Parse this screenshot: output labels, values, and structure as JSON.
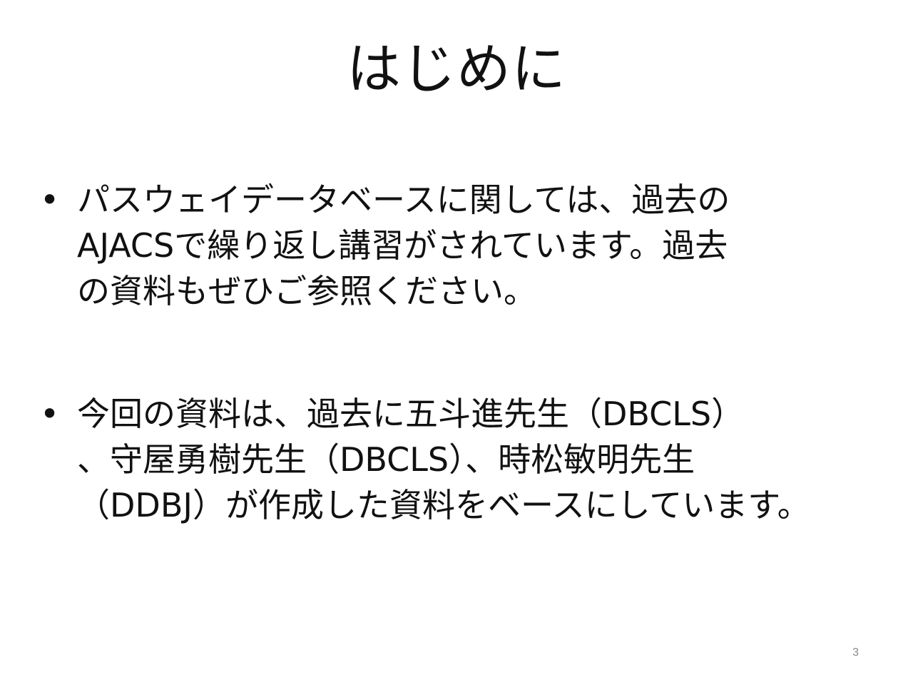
{
  "slide": {
    "title": "はじめに",
    "bullet_symbol": "•",
    "bullets": [
      {
        "lines": [
          "パスウェイデータベースに関しては、過去の",
          "AJACSで繰り返し講習がされています。過去",
          "の資料もぜひご参照ください。"
        ]
      },
      {
        "lines": [
          "今回の資料は、過去に五斗進先生（DBCLS）",
          "、守屋勇樹先生（DBCLS）、時松敏明先生",
          "（DDBJ）が作成した資料をベースにしています。"
        ]
      }
    ],
    "page_number": "3"
  }
}
